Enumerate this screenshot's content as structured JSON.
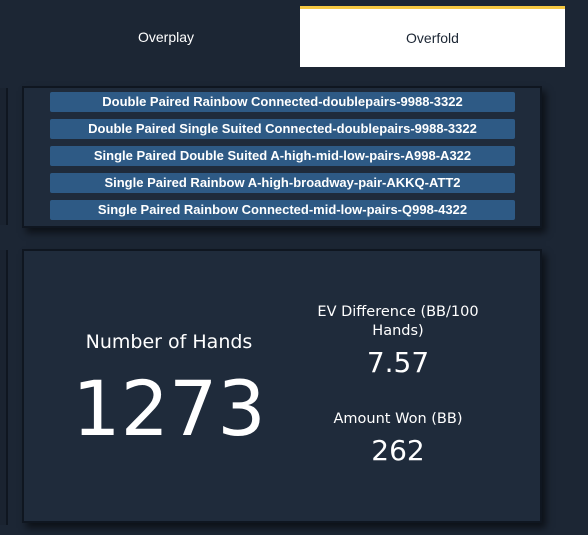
{
  "tabs": {
    "overplay": "Overplay",
    "overfold": "Overfold",
    "active": "Overfold"
  },
  "colors": {
    "background": "#1c2634",
    "panel": "#1f2b3b",
    "list_item": "#2e5a85",
    "active_tab_accent": "#f5c842"
  },
  "hand_types": [
    "Double Paired Rainbow Connected-doublepairs-9988-3322",
    "Double Paired Single Suited Connected-doublepairs-9988-3322",
    "Single Paired Double Suited A-high-mid-low-pairs-A998-A322",
    "Single Paired Rainbow A-high-broadway-pair-AKKQ-ATT2",
    "Single Paired Rainbow Connected-mid-low-pairs-Q998-4322"
  ],
  "stats": {
    "hands_label": "Number of Hands",
    "hands_value": "1273",
    "ev_label": "EV Difference (BB/100 Hands)",
    "ev_value": "7.57",
    "won_label": "Amount Won (BB)",
    "won_value": "262"
  }
}
